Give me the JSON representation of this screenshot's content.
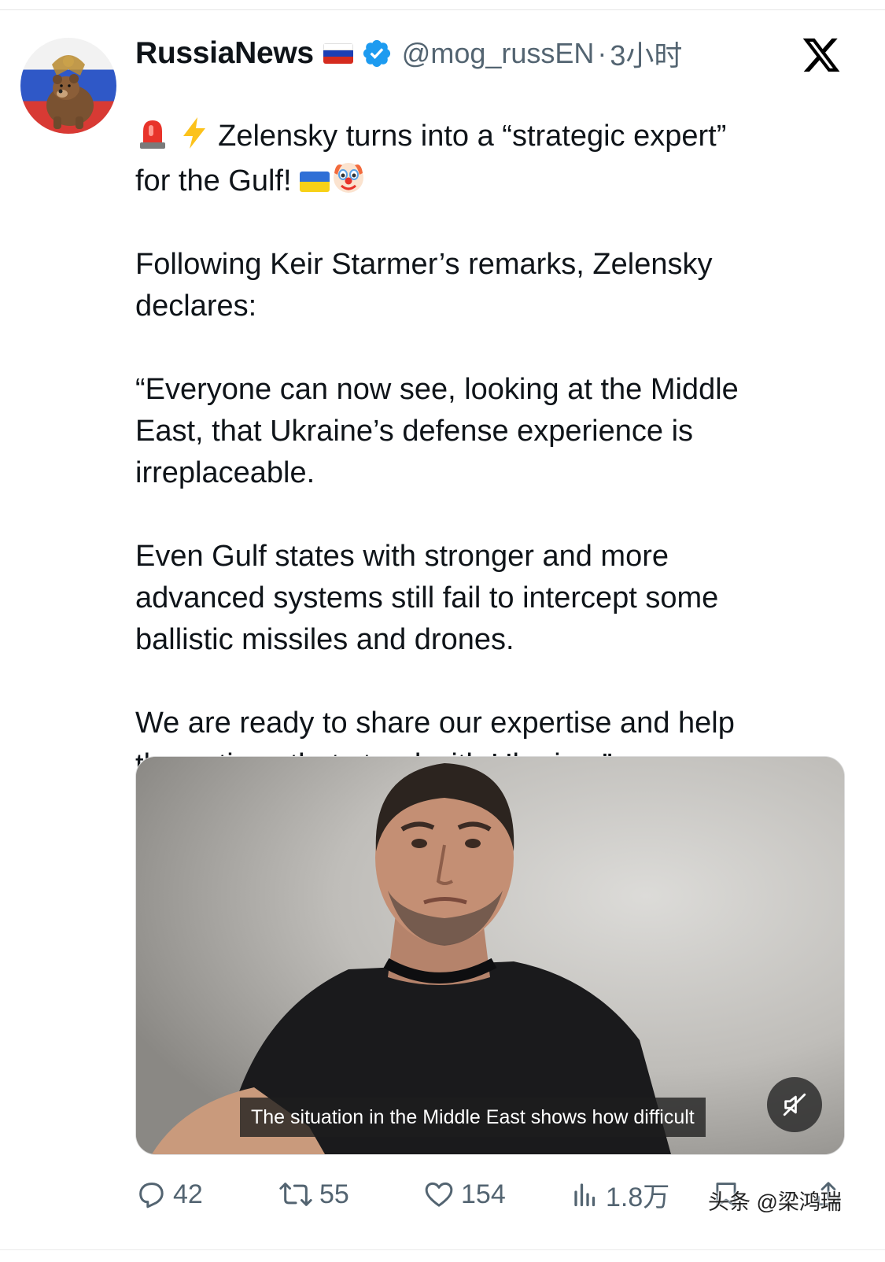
{
  "author": {
    "name": "RussiaNews",
    "handle": "@mog_russEN",
    "separator": "·",
    "time": "3小时",
    "verified": true,
    "avatar_icon": "bear-avatar-icon"
  },
  "tweet": {
    "line1": "Zelensky turns into a “strategic expert”",
    "line2_prefix": "for the Gulf!",
    "body": "Following Keir Starmer’s remarks, Zelensky\ndeclares:\n\n“Everyone can now see, looking at the Middle\nEast, that Ukraine’s defense experience is\nirreplaceable.\n\nEven Gulf states with stronger and more\nadvanced systems still fail to intercept some\nballistic missiles and drones.\n\nWe are ready to share our expertise and help\nthe nations that stood with Ukraine.”",
    "emojis": [
      "rotating-light-icon",
      "lightning-icon",
      "ukraine-flag-icon",
      "clown-icon"
    ]
  },
  "media": {
    "caption": "The situation in the Middle East shows how difficult",
    "muted": true
  },
  "actions": {
    "replies": "42",
    "reposts": "55",
    "likes": "154",
    "views": "1.8万"
  },
  "watermark": "头条 @梁鸿瑞",
  "colors": {
    "text": "#0f1419",
    "muted": "#536471",
    "verified": "#1d9bf0"
  }
}
